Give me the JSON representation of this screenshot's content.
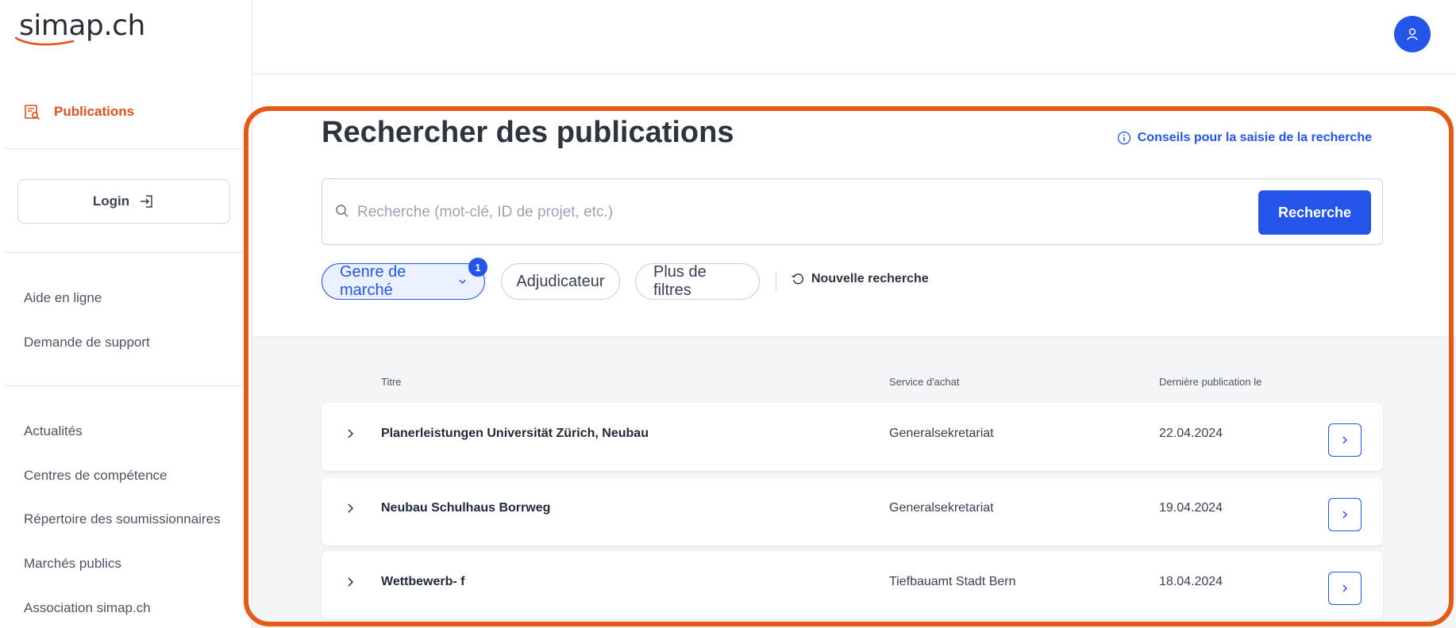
{
  "brand": {
    "logo_text": "simap.ch",
    "accent_color": "#e0501b",
    "primary_color": "#2554e8",
    "highlight_color": "#e65a17"
  },
  "sidebar": {
    "active_item": {
      "label": "Publications",
      "icon": "search-document-icon"
    },
    "login_label": "Login",
    "help_links": [
      "Aide en ligne",
      "Demande de support"
    ],
    "info_links": [
      "Actualités",
      "Centres de compétence",
      "Répertoire des soumissionnaires",
      "Marchés publics",
      "Association simap.ch"
    ]
  },
  "header": {
    "avatar_icon": "user-icon"
  },
  "search": {
    "title": "Rechercher des publications",
    "tips_label": "Conseils pour la saisie de la recherche",
    "placeholder": "Recherche (mot-clé, ID de projet, etc.)",
    "value": "",
    "button_label": "Recherche",
    "filters": {
      "market_type": {
        "label": "Genre de marché",
        "badge": "1"
      },
      "contracting": {
        "label": "Adjudicateur"
      },
      "more": {
        "label": "Plus de filtres"
      },
      "reset_label": "Nouvelle recherche"
    }
  },
  "table": {
    "columns": {
      "title": "Titre",
      "service": "Service d'achat",
      "date": "Dernière publication le"
    },
    "rows": [
      {
        "title": "Planerleistungen Universität Zürich, Neubau",
        "service": "Generalsekretariat",
        "date": "22.04.2024"
      },
      {
        "title": "Neubau Schulhaus Borrweg",
        "service": "Generalsekretariat",
        "date": "19.04.2024"
      },
      {
        "title": "Wettbewerb- f",
        "service": "Tiefbauamt Stadt Bern",
        "date": "18.04.2024"
      }
    ]
  }
}
